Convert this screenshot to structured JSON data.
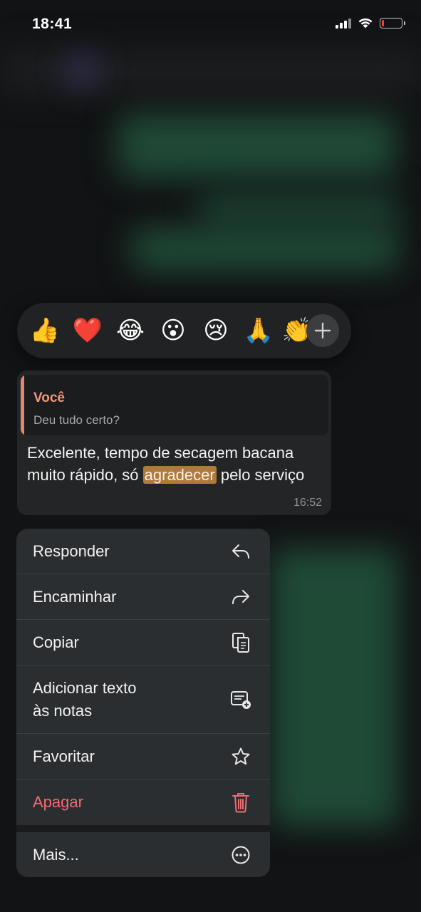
{
  "status_bar": {
    "time": "18:41"
  },
  "reactions": {
    "emojis": [
      "👍",
      "❤️",
      "😂",
      "😮",
      "😢",
      "🙏",
      "👏"
    ],
    "more_icon": "plus-icon"
  },
  "message": {
    "quote_author": "Você",
    "quote_text": "Deu tudo certo?",
    "text_before": "Excelente, tempo de secagem bacana muito rápido, só ",
    "text_highlight": "agradecer",
    "text_after": " pelo serviço",
    "time": "16:52"
  },
  "menu": {
    "reply": {
      "label": "Responder",
      "icon": "reply-icon"
    },
    "forward": {
      "label": "Encaminhar",
      "icon": "forward-icon"
    },
    "copy": {
      "label": "Copiar",
      "icon": "copy-icon"
    },
    "add_to_notes": {
      "label_line1": "Adicionar texto",
      "label_line2": "às notas",
      "icon": "note-add-icon"
    },
    "favorite": {
      "label": "Favoritar",
      "icon": "star-icon"
    },
    "delete": {
      "label": "Apagar",
      "icon": "trash-icon",
      "color": "#ef6c72"
    },
    "more": {
      "label": "Mais...",
      "icon": "more-icon"
    }
  }
}
